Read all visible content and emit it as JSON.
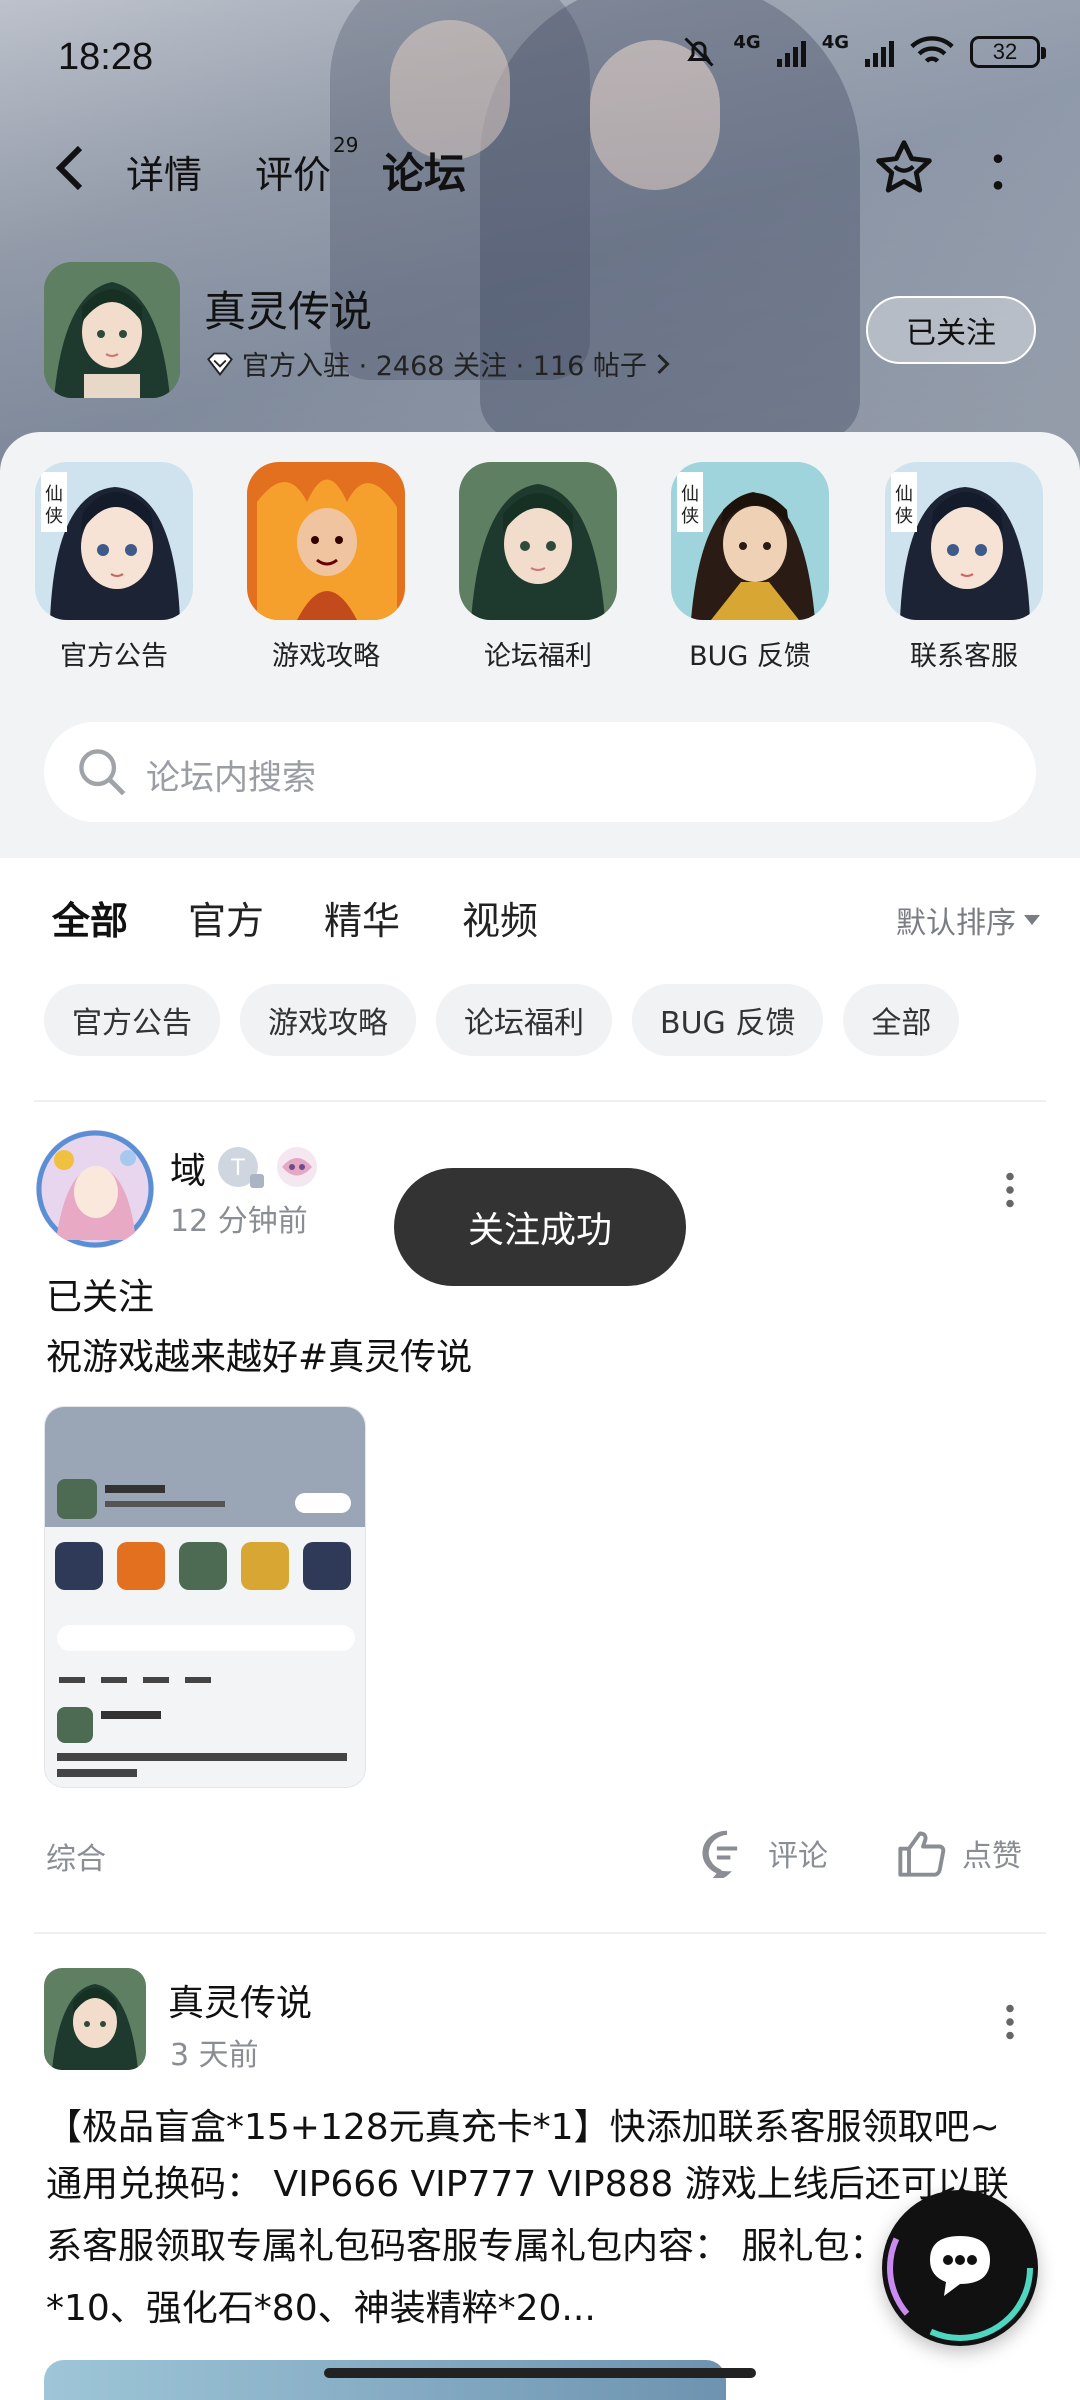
{
  "status_bar": {
    "time": "18:28",
    "net1": "4G",
    "net2": "4G",
    "battery": "32"
  },
  "nav": {
    "tabs": [
      {
        "label": "详情"
      },
      {
        "label": "评价",
        "badge": "29"
      },
      {
        "label": "论坛"
      }
    ],
    "active_tab": "论坛"
  },
  "game": {
    "name": "真灵传说",
    "meta": "官方入驻 · 2468 关注 · 116 帖子",
    "follow_label": "已关注"
  },
  "categories": [
    {
      "label": "官方公告",
      "icon": "xianxia-girl"
    },
    {
      "label": "游戏攻略",
      "icon": "fire-warrior"
    },
    {
      "label": "论坛福利",
      "icon": "green-haired-lady"
    },
    {
      "label": "BUG 反馈",
      "icon": "xianxia-man"
    },
    {
      "label": "联系客服",
      "icon": "xianxia-girl"
    }
  ],
  "search": {
    "placeholder": "论坛内搜索"
  },
  "feed_tabs": [
    "全部",
    "官方",
    "精华",
    "视频"
  ],
  "feed_active": "全部",
  "sort_label": "默认排序",
  "chips": [
    "官方公告",
    "游戏攻略",
    "论坛福利",
    "BUG 反馈",
    "全部"
  ],
  "posts": [
    {
      "user": "域",
      "time": "12 分钟前",
      "title": "已关注",
      "body": "祝游戏越来越好#真灵传说",
      "tag": "综合",
      "comment_label": "评论",
      "like_label": "点赞"
    },
    {
      "user": "真灵传说",
      "time": "3 天前",
      "title": "【极品盲盒*15+128元真充卡*1】快添加联系客服领取吧~",
      "body": "通用兑换码：  VIP666  VIP777  VIP888 游戏上线后还可以联系客服领取专属礼包码客服专属礼包内容：  服礼包：绝品盲盒*10、强化石*80、神装精粹*20..."
    }
  ],
  "toast": "关注成功",
  "colors": {
    "accent": "#4fd6c0",
    "toast_bg": "#333333",
    "panel_bg": "#f2f3f5"
  }
}
